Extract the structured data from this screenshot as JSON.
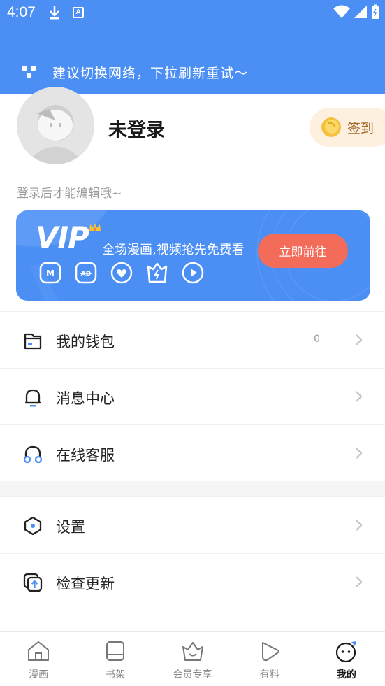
{
  "status_bar": {
    "time": "4:07",
    "a_badge": "A"
  },
  "network_banner": {
    "message": "建议切换网络，下拉刷新重试～"
  },
  "profile": {
    "name": "未登录",
    "hint": "登录后才能编辑哦~",
    "signin_label": "签到"
  },
  "vip": {
    "logo": "VIP",
    "slogan": "全场漫画,视频抢先免费看",
    "cta": "立即前往",
    "accent": "#f36c59"
  },
  "menu": {
    "group1": [
      {
        "label": "我的钱包",
        "value": "0",
        "icon": "wallet-icon"
      },
      {
        "label": "消息中心",
        "value": "",
        "icon": "bell-icon"
      },
      {
        "label": "在线客服",
        "value": "",
        "icon": "headset-icon"
      }
    ],
    "group2": [
      {
        "label": "设置",
        "icon": "settings-icon"
      },
      {
        "label": "检查更新",
        "icon": "update-icon"
      }
    ]
  },
  "tabs": [
    {
      "label": "漫画",
      "icon": "home-icon"
    },
    {
      "label": "书架",
      "icon": "bookshelf-icon"
    },
    {
      "label": "会员专享",
      "icon": "vip-basket-icon"
    },
    {
      "label": "有料",
      "icon": "play-icon"
    },
    {
      "label": "我的",
      "icon": "profile-face-icon",
      "active": true
    }
  ],
  "colors": {
    "primary": "#4b8ff5",
    "gold": "#a3682a"
  }
}
